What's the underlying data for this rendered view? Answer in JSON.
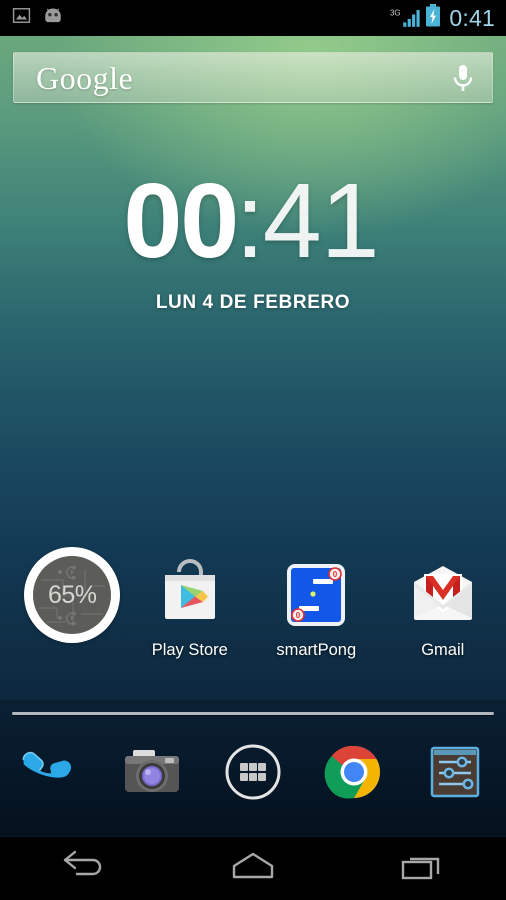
{
  "status_bar": {
    "left_icons": [
      "screenshot-image-icon",
      "android-droid-icon"
    ],
    "network_label": "3G",
    "signal_icon": "signal-bars-icon",
    "battery_icon": "battery-charging-icon",
    "clock": "0:41",
    "clock_color": "#9fd3e8"
  },
  "search": {
    "brand": "Google",
    "placeholder": "Google",
    "mic_icon": "microphone-icon"
  },
  "clock_widget": {
    "hours": "00",
    "separator": ":",
    "minutes": "41",
    "date": "LUN 4 DE FEBRERO"
  },
  "apps": [
    {
      "name": "battery-widget",
      "label": "",
      "percent": "65%",
      "icon": "battery-circle-widget"
    },
    {
      "name": "play-store",
      "label": "Play Store",
      "icon": "play-store-icon"
    },
    {
      "name": "smartpong",
      "label": "smartPong",
      "icon": "smartpong-icon",
      "score_left": "0",
      "score_right": "0"
    },
    {
      "name": "gmail",
      "label": "Gmail",
      "icon": "gmail-icon"
    }
  ],
  "dock": [
    {
      "name": "phone",
      "icon": "phone-handset-icon"
    },
    {
      "name": "camera",
      "icon": "camera-icon"
    },
    {
      "name": "app-drawer",
      "icon": "app-drawer-icon"
    },
    {
      "name": "chrome",
      "icon": "chrome-icon"
    },
    {
      "name": "settings",
      "icon": "settings-sliders-icon"
    }
  ],
  "nav_bar": [
    {
      "name": "back",
      "icon": "back-arrow-icon"
    },
    {
      "name": "home",
      "icon": "home-pentagon-icon"
    },
    {
      "name": "recents",
      "icon": "recent-apps-icon"
    }
  ],
  "colors": {
    "wallpaper_top": "#6aa77c",
    "wallpaper_bottom": "#07192a",
    "accent_blue": "#2f7ddb",
    "status_text": "#9fd3e8"
  }
}
